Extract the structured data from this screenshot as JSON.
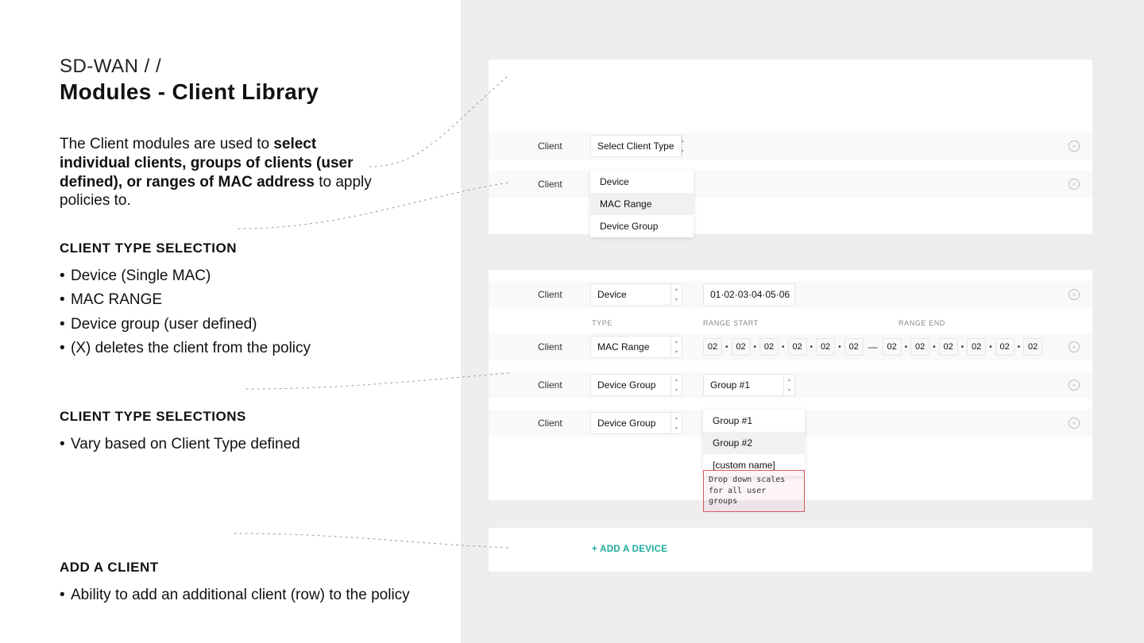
{
  "breadcrumb": "SD-WAN / /",
  "title": "Modules - Client Library",
  "intro": {
    "pre": "The Client modules are used to ",
    "bold": "select individual clients, groups of clients (user defined), or ranges of MAC address",
    "post": " to apply policies to."
  },
  "sections": {
    "s1": {
      "heading": "CLIENT TYPE SELECTION",
      "items": [
        "Device (Single MAC)",
        "MAC RANGE",
        "Device group (user defined)",
        "(X) deletes the client from the policy"
      ]
    },
    "s2": {
      "heading": "CLIENT TYPE SELECTIONS",
      "items": [
        "Vary based on Client Type defined"
      ]
    },
    "s3": {
      "heading": "ADD A CLIENT",
      "items": [
        "Ability to add an additional client (row) to the policy"
      ]
    }
  },
  "panel1": {
    "row1": {
      "label": "Client",
      "select": "Select Client Type"
    },
    "row2": {
      "label": "Client",
      "options": [
        "Device",
        "MAC Range",
        "Device Group"
      ],
      "highlightIndex": 1
    }
  },
  "panel2": {
    "rowDevice": {
      "label": "Client",
      "select": "Device",
      "value": "01·02·03·04·05·06"
    },
    "headers": {
      "type": "TYPE",
      "start": "RANGE START",
      "end": "RANGE END"
    },
    "rowMac": {
      "label": "Client",
      "select": "MAC Range",
      "start": [
        "02",
        "02",
        "02",
        "02",
        "02",
        "02"
      ],
      "end": [
        "02",
        "02",
        "02",
        "02",
        "02",
        "02"
      ]
    },
    "rowGroup": {
      "label": "Client",
      "select": "Device Group",
      "value": "Group #1"
    },
    "rowGroupOpen": {
      "label": "Client",
      "select": "Device Group",
      "options": [
        "Group #1",
        "Group #2",
        "[custom name]"
      ],
      "note": "Drop down scales for all user groups"
    }
  },
  "panel3": {
    "add": "+ ADD A DEVICE"
  }
}
